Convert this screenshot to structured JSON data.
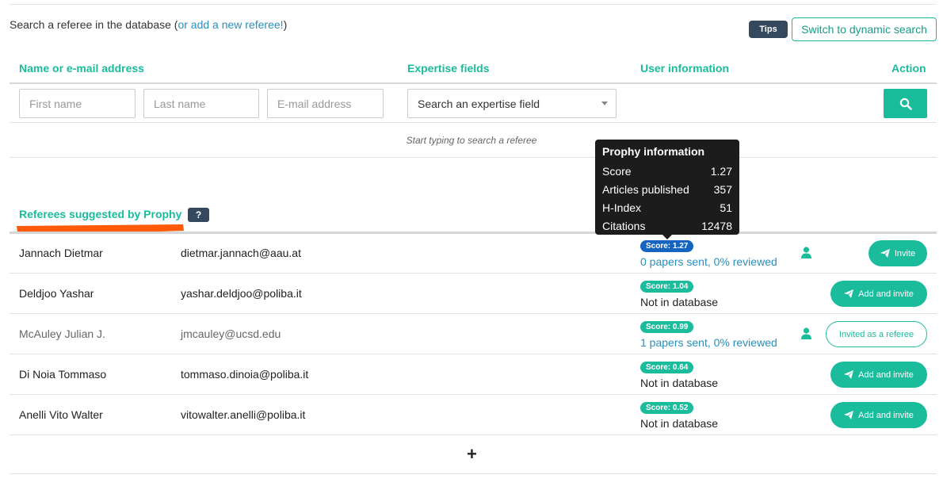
{
  "search": {
    "intro_text": "Search a referee in the database (",
    "add_link": "or add a new referee!",
    "intro_close": ")",
    "tips_label": "Tips",
    "switch_label": "Switch to dynamic search",
    "first_name_placeholder": "First name",
    "last_name_placeholder": "Last name",
    "email_placeholder": "E-mail address",
    "expertise_placeholder": "Search an expertise field",
    "hint": "Start typing to search a referee"
  },
  "columns": {
    "name": "Name or e-mail address",
    "expertise": "Expertise fields",
    "user_info": "User information",
    "action": "Action"
  },
  "suggested": {
    "title": "Referees suggested by Prophy",
    "help": "?"
  },
  "tooltip": {
    "title": "Prophy information",
    "rows": [
      {
        "label": "Score",
        "value": "1.27"
      },
      {
        "label": "Articles published",
        "value": "357"
      },
      {
        "label": "H-Index",
        "value": "51"
      },
      {
        "label": "Citations",
        "value": "12478"
      }
    ]
  },
  "referees": [
    {
      "name": "Jannach Dietmar",
      "email": "dietmar.jannach@aau.at",
      "score": "Score: 1.27",
      "status": "0 papers sent, 0% reviewed",
      "action": "Invite"
    },
    {
      "name": "Deldjoo Yashar",
      "email": "yashar.deldjoo@poliba.it",
      "score": "Score: 1.04",
      "status": "Not in database",
      "action": "Add and invite"
    },
    {
      "name": "McAuley Julian J.",
      "email": "jmcauley@ucsd.edu",
      "score": "Score: 0.99",
      "status": "1 papers sent, 0% reviewed",
      "action": "Invited as a referee"
    },
    {
      "name": "Di Noia Tommaso",
      "email": "tommaso.dinoia@poliba.it",
      "score": "Score: 0.64",
      "status": "Not in database",
      "action": "Add and invite"
    },
    {
      "name": "Anelli Vito Walter",
      "email": "vitowalter.anelli@poliba.it",
      "score": "Score: 0.52",
      "status": "Not in database",
      "action": "Add and invite"
    }
  ],
  "more": "+",
  "colors": {
    "accent": "#1abc9c",
    "score_highlight": "#1565c0",
    "link": "#2a8fbd",
    "dark_badge": "#34495e",
    "annotation": "#ff5a0a"
  }
}
